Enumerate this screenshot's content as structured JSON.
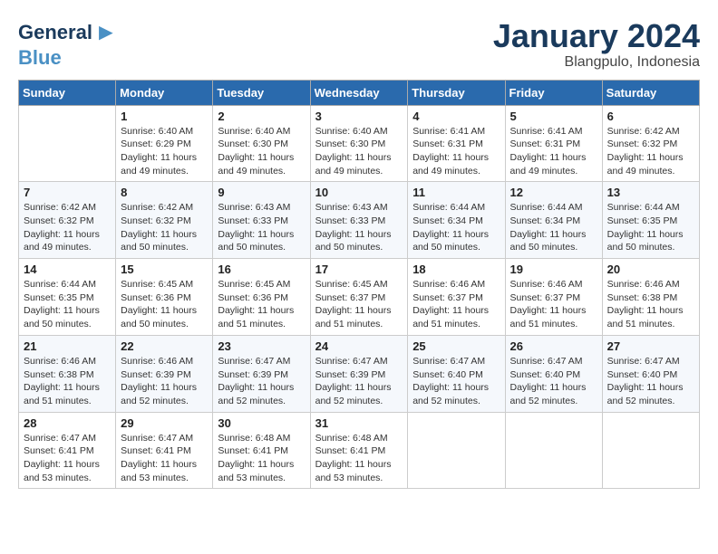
{
  "header": {
    "logo_line1": "General",
    "logo_line2": "Blue",
    "title": "January 2024",
    "subtitle": "Blangpulo, Indonesia"
  },
  "calendar": {
    "days_of_week": [
      "Sunday",
      "Monday",
      "Tuesday",
      "Wednesday",
      "Thursday",
      "Friday",
      "Saturday"
    ],
    "weeks": [
      [
        {
          "day": "",
          "info": ""
        },
        {
          "day": "1",
          "info": "Sunrise: 6:40 AM\nSunset: 6:29 PM\nDaylight: 11 hours\nand 49 minutes."
        },
        {
          "day": "2",
          "info": "Sunrise: 6:40 AM\nSunset: 6:30 PM\nDaylight: 11 hours\nand 49 minutes."
        },
        {
          "day": "3",
          "info": "Sunrise: 6:40 AM\nSunset: 6:30 PM\nDaylight: 11 hours\nand 49 minutes."
        },
        {
          "day": "4",
          "info": "Sunrise: 6:41 AM\nSunset: 6:31 PM\nDaylight: 11 hours\nand 49 minutes."
        },
        {
          "day": "5",
          "info": "Sunrise: 6:41 AM\nSunset: 6:31 PM\nDaylight: 11 hours\nand 49 minutes."
        },
        {
          "day": "6",
          "info": "Sunrise: 6:42 AM\nSunset: 6:32 PM\nDaylight: 11 hours\nand 49 minutes."
        }
      ],
      [
        {
          "day": "7",
          "info": "Sunrise: 6:42 AM\nSunset: 6:32 PM\nDaylight: 11 hours\nand 49 minutes."
        },
        {
          "day": "8",
          "info": "Sunrise: 6:42 AM\nSunset: 6:32 PM\nDaylight: 11 hours\nand 50 minutes."
        },
        {
          "day": "9",
          "info": "Sunrise: 6:43 AM\nSunset: 6:33 PM\nDaylight: 11 hours\nand 50 minutes."
        },
        {
          "day": "10",
          "info": "Sunrise: 6:43 AM\nSunset: 6:33 PM\nDaylight: 11 hours\nand 50 minutes."
        },
        {
          "day": "11",
          "info": "Sunrise: 6:44 AM\nSunset: 6:34 PM\nDaylight: 11 hours\nand 50 minutes."
        },
        {
          "day": "12",
          "info": "Sunrise: 6:44 AM\nSunset: 6:34 PM\nDaylight: 11 hours\nand 50 minutes."
        },
        {
          "day": "13",
          "info": "Sunrise: 6:44 AM\nSunset: 6:35 PM\nDaylight: 11 hours\nand 50 minutes."
        }
      ],
      [
        {
          "day": "14",
          "info": "Sunrise: 6:44 AM\nSunset: 6:35 PM\nDaylight: 11 hours\nand 50 minutes."
        },
        {
          "day": "15",
          "info": "Sunrise: 6:45 AM\nSunset: 6:36 PM\nDaylight: 11 hours\nand 50 minutes."
        },
        {
          "day": "16",
          "info": "Sunrise: 6:45 AM\nSunset: 6:36 PM\nDaylight: 11 hours\nand 51 minutes."
        },
        {
          "day": "17",
          "info": "Sunrise: 6:45 AM\nSunset: 6:37 PM\nDaylight: 11 hours\nand 51 minutes."
        },
        {
          "day": "18",
          "info": "Sunrise: 6:46 AM\nSunset: 6:37 PM\nDaylight: 11 hours\nand 51 minutes."
        },
        {
          "day": "19",
          "info": "Sunrise: 6:46 AM\nSunset: 6:37 PM\nDaylight: 11 hours\nand 51 minutes."
        },
        {
          "day": "20",
          "info": "Sunrise: 6:46 AM\nSunset: 6:38 PM\nDaylight: 11 hours\nand 51 minutes."
        }
      ],
      [
        {
          "day": "21",
          "info": "Sunrise: 6:46 AM\nSunset: 6:38 PM\nDaylight: 11 hours\nand 51 minutes."
        },
        {
          "day": "22",
          "info": "Sunrise: 6:46 AM\nSunset: 6:39 PM\nDaylight: 11 hours\nand 52 minutes."
        },
        {
          "day": "23",
          "info": "Sunrise: 6:47 AM\nSunset: 6:39 PM\nDaylight: 11 hours\nand 52 minutes."
        },
        {
          "day": "24",
          "info": "Sunrise: 6:47 AM\nSunset: 6:39 PM\nDaylight: 11 hours\nand 52 minutes."
        },
        {
          "day": "25",
          "info": "Sunrise: 6:47 AM\nSunset: 6:40 PM\nDaylight: 11 hours\nand 52 minutes."
        },
        {
          "day": "26",
          "info": "Sunrise: 6:47 AM\nSunset: 6:40 PM\nDaylight: 11 hours\nand 52 minutes."
        },
        {
          "day": "27",
          "info": "Sunrise: 6:47 AM\nSunset: 6:40 PM\nDaylight: 11 hours\nand 52 minutes."
        }
      ],
      [
        {
          "day": "28",
          "info": "Sunrise: 6:47 AM\nSunset: 6:41 PM\nDaylight: 11 hours\nand 53 minutes."
        },
        {
          "day": "29",
          "info": "Sunrise: 6:47 AM\nSunset: 6:41 PM\nDaylight: 11 hours\nand 53 minutes."
        },
        {
          "day": "30",
          "info": "Sunrise: 6:48 AM\nSunset: 6:41 PM\nDaylight: 11 hours\nand 53 minutes."
        },
        {
          "day": "31",
          "info": "Sunrise: 6:48 AM\nSunset: 6:41 PM\nDaylight: 11 hours\nand 53 minutes."
        },
        {
          "day": "",
          "info": ""
        },
        {
          "day": "",
          "info": ""
        },
        {
          "day": "",
          "info": ""
        }
      ]
    ]
  }
}
